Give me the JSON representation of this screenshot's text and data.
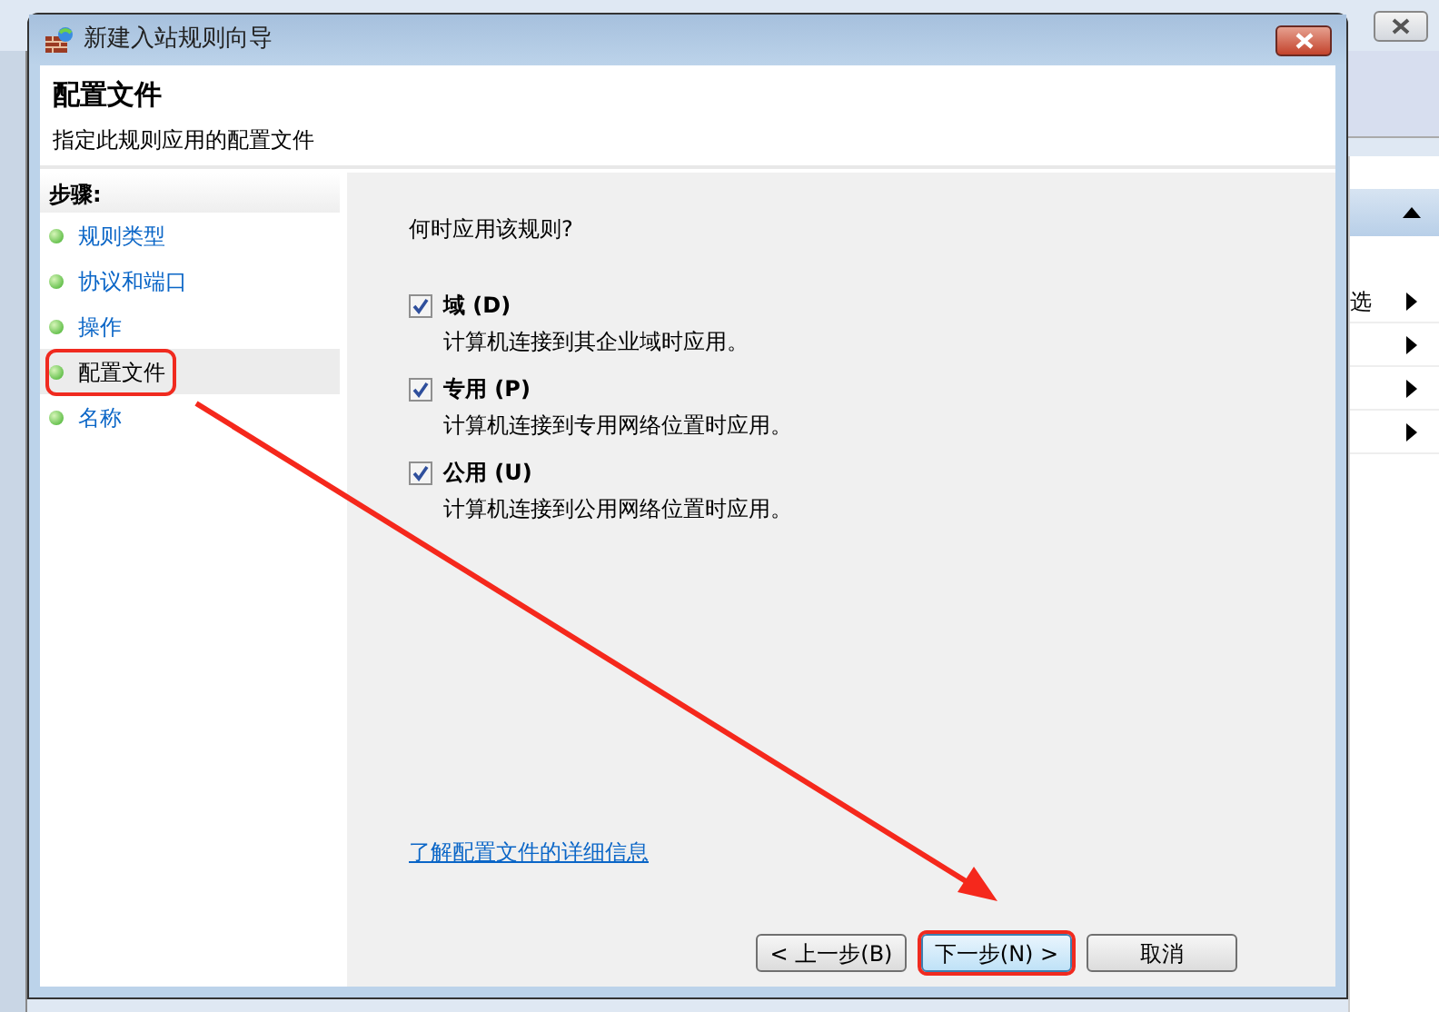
{
  "window": {
    "title": "新建入站规则向导"
  },
  "header": {
    "title": "配置文件",
    "subtitle": "指定此规则应用的配置文件"
  },
  "steps": {
    "heading": "步骤:",
    "items": [
      {
        "label": "规则类型",
        "selected": false,
        "highlighted": false
      },
      {
        "label": "协议和端口",
        "selected": false,
        "highlighted": false
      },
      {
        "label": "操作",
        "selected": false,
        "highlighted": false
      },
      {
        "label": "配置文件",
        "selected": true,
        "highlighted": true
      },
      {
        "label": "名称",
        "selected": false,
        "highlighted": false
      }
    ]
  },
  "content": {
    "question": "何时应用该规则?",
    "options": [
      {
        "label": "域 (D)",
        "description": "计算机连接到其企业域时应用。",
        "checked": true
      },
      {
        "label": "专用 (P)",
        "description": "计算机连接到专用网络位置时应用。",
        "checked": true
      },
      {
        "label": "公用 (U)",
        "description": "计算机连接到公用网络位置时应用。",
        "checked": true
      }
    ],
    "link": "了解配置文件的详细信息"
  },
  "buttons": [
    {
      "label": "< 上一步(B)",
      "highlighted": false
    },
    {
      "label": "下一步(N) >",
      "highlighted": true
    },
    {
      "label": "取消",
      "highlighted": false
    }
  ],
  "background_window": {
    "menu_label": "选"
  }
}
